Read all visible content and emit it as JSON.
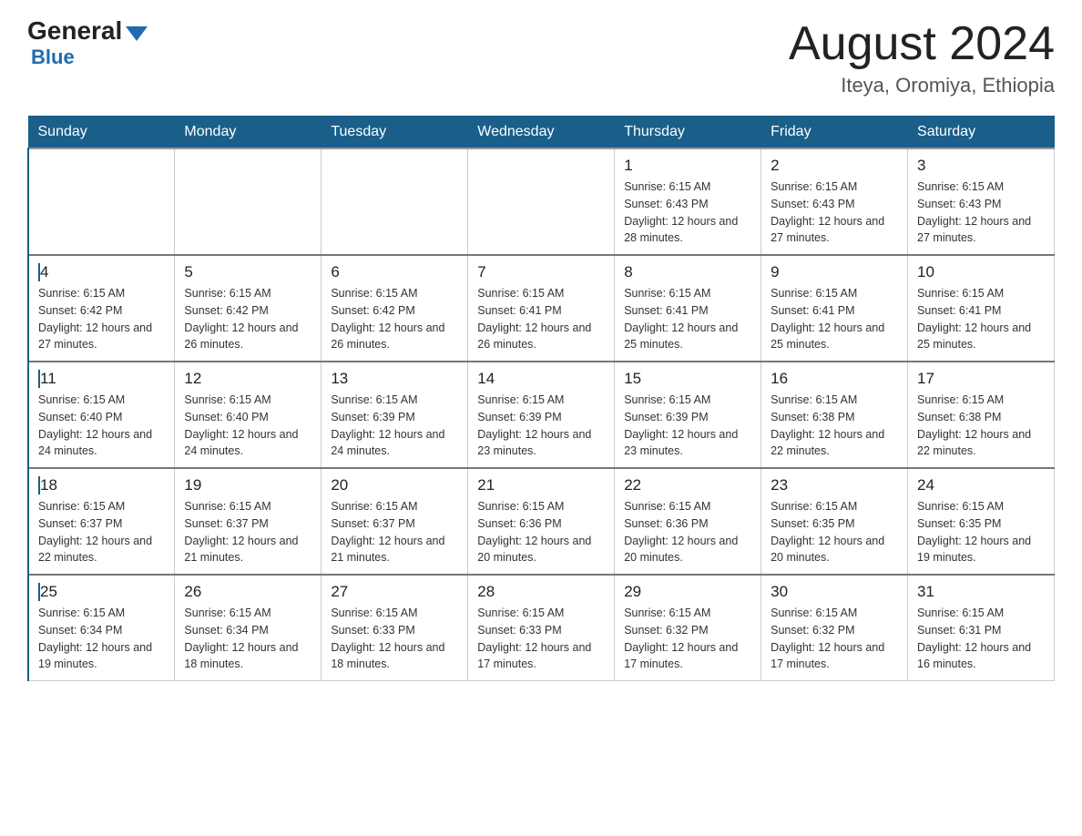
{
  "logo": {
    "general": "General",
    "blue": "Blue"
  },
  "title": "August 2024",
  "location": "Iteya, Oromiya, Ethiopia",
  "days_of_week": [
    "Sunday",
    "Monday",
    "Tuesday",
    "Wednesday",
    "Thursday",
    "Friday",
    "Saturday"
  ],
  "weeks": [
    [
      {
        "day": "",
        "sunrise": "",
        "sunset": "",
        "daylight": ""
      },
      {
        "day": "",
        "sunrise": "",
        "sunset": "",
        "daylight": ""
      },
      {
        "day": "",
        "sunrise": "",
        "sunset": "",
        "daylight": ""
      },
      {
        "day": "",
        "sunrise": "",
        "sunset": "",
        "daylight": ""
      },
      {
        "day": "1",
        "sunrise": "Sunrise: 6:15 AM",
        "sunset": "Sunset: 6:43 PM",
        "daylight": "Daylight: 12 hours and 28 minutes."
      },
      {
        "day": "2",
        "sunrise": "Sunrise: 6:15 AM",
        "sunset": "Sunset: 6:43 PM",
        "daylight": "Daylight: 12 hours and 27 minutes."
      },
      {
        "day": "3",
        "sunrise": "Sunrise: 6:15 AM",
        "sunset": "Sunset: 6:43 PM",
        "daylight": "Daylight: 12 hours and 27 minutes."
      }
    ],
    [
      {
        "day": "4",
        "sunrise": "Sunrise: 6:15 AM",
        "sunset": "Sunset: 6:42 PM",
        "daylight": "Daylight: 12 hours and 27 minutes."
      },
      {
        "day": "5",
        "sunrise": "Sunrise: 6:15 AM",
        "sunset": "Sunset: 6:42 PM",
        "daylight": "Daylight: 12 hours and 26 minutes."
      },
      {
        "day": "6",
        "sunrise": "Sunrise: 6:15 AM",
        "sunset": "Sunset: 6:42 PM",
        "daylight": "Daylight: 12 hours and 26 minutes."
      },
      {
        "day": "7",
        "sunrise": "Sunrise: 6:15 AM",
        "sunset": "Sunset: 6:41 PM",
        "daylight": "Daylight: 12 hours and 26 minutes."
      },
      {
        "day": "8",
        "sunrise": "Sunrise: 6:15 AM",
        "sunset": "Sunset: 6:41 PM",
        "daylight": "Daylight: 12 hours and 25 minutes."
      },
      {
        "day": "9",
        "sunrise": "Sunrise: 6:15 AM",
        "sunset": "Sunset: 6:41 PM",
        "daylight": "Daylight: 12 hours and 25 minutes."
      },
      {
        "day": "10",
        "sunrise": "Sunrise: 6:15 AM",
        "sunset": "Sunset: 6:41 PM",
        "daylight": "Daylight: 12 hours and 25 minutes."
      }
    ],
    [
      {
        "day": "11",
        "sunrise": "Sunrise: 6:15 AM",
        "sunset": "Sunset: 6:40 PM",
        "daylight": "Daylight: 12 hours and 24 minutes."
      },
      {
        "day": "12",
        "sunrise": "Sunrise: 6:15 AM",
        "sunset": "Sunset: 6:40 PM",
        "daylight": "Daylight: 12 hours and 24 minutes."
      },
      {
        "day": "13",
        "sunrise": "Sunrise: 6:15 AM",
        "sunset": "Sunset: 6:39 PM",
        "daylight": "Daylight: 12 hours and 24 minutes."
      },
      {
        "day": "14",
        "sunrise": "Sunrise: 6:15 AM",
        "sunset": "Sunset: 6:39 PM",
        "daylight": "Daylight: 12 hours and 23 minutes."
      },
      {
        "day": "15",
        "sunrise": "Sunrise: 6:15 AM",
        "sunset": "Sunset: 6:39 PM",
        "daylight": "Daylight: 12 hours and 23 minutes."
      },
      {
        "day": "16",
        "sunrise": "Sunrise: 6:15 AM",
        "sunset": "Sunset: 6:38 PM",
        "daylight": "Daylight: 12 hours and 22 minutes."
      },
      {
        "day": "17",
        "sunrise": "Sunrise: 6:15 AM",
        "sunset": "Sunset: 6:38 PM",
        "daylight": "Daylight: 12 hours and 22 minutes."
      }
    ],
    [
      {
        "day": "18",
        "sunrise": "Sunrise: 6:15 AM",
        "sunset": "Sunset: 6:37 PM",
        "daylight": "Daylight: 12 hours and 22 minutes."
      },
      {
        "day": "19",
        "sunrise": "Sunrise: 6:15 AM",
        "sunset": "Sunset: 6:37 PM",
        "daylight": "Daylight: 12 hours and 21 minutes."
      },
      {
        "day": "20",
        "sunrise": "Sunrise: 6:15 AM",
        "sunset": "Sunset: 6:37 PM",
        "daylight": "Daylight: 12 hours and 21 minutes."
      },
      {
        "day": "21",
        "sunrise": "Sunrise: 6:15 AM",
        "sunset": "Sunset: 6:36 PM",
        "daylight": "Daylight: 12 hours and 20 minutes."
      },
      {
        "day": "22",
        "sunrise": "Sunrise: 6:15 AM",
        "sunset": "Sunset: 6:36 PM",
        "daylight": "Daylight: 12 hours and 20 minutes."
      },
      {
        "day": "23",
        "sunrise": "Sunrise: 6:15 AM",
        "sunset": "Sunset: 6:35 PM",
        "daylight": "Daylight: 12 hours and 20 minutes."
      },
      {
        "day": "24",
        "sunrise": "Sunrise: 6:15 AM",
        "sunset": "Sunset: 6:35 PM",
        "daylight": "Daylight: 12 hours and 19 minutes."
      }
    ],
    [
      {
        "day": "25",
        "sunrise": "Sunrise: 6:15 AM",
        "sunset": "Sunset: 6:34 PM",
        "daylight": "Daylight: 12 hours and 19 minutes."
      },
      {
        "day": "26",
        "sunrise": "Sunrise: 6:15 AM",
        "sunset": "Sunset: 6:34 PM",
        "daylight": "Daylight: 12 hours and 18 minutes."
      },
      {
        "day": "27",
        "sunrise": "Sunrise: 6:15 AM",
        "sunset": "Sunset: 6:33 PM",
        "daylight": "Daylight: 12 hours and 18 minutes."
      },
      {
        "day": "28",
        "sunrise": "Sunrise: 6:15 AM",
        "sunset": "Sunset: 6:33 PM",
        "daylight": "Daylight: 12 hours and 17 minutes."
      },
      {
        "day": "29",
        "sunrise": "Sunrise: 6:15 AM",
        "sunset": "Sunset: 6:32 PM",
        "daylight": "Daylight: 12 hours and 17 minutes."
      },
      {
        "day": "30",
        "sunrise": "Sunrise: 6:15 AM",
        "sunset": "Sunset: 6:32 PM",
        "daylight": "Daylight: 12 hours and 17 minutes."
      },
      {
        "day": "31",
        "sunrise": "Sunrise: 6:15 AM",
        "sunset": "Sunset: 6:31 PM",
        "daylight": "Daylight: 12 hours and 16 minutes."
      }
    ]
  ]
}
